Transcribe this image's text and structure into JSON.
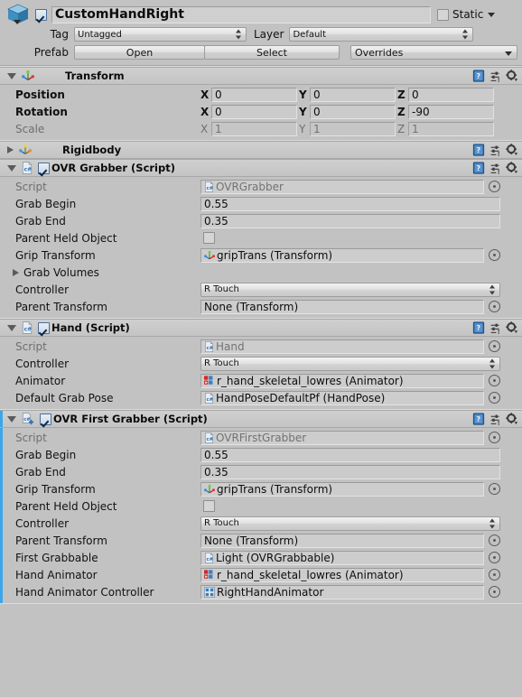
{
  "object_header": {
    "icon": "cube-icon",
    "enabled": true,
    "name": "CustomHandRight",
    "static_label": "Static",
    "static_checked": false,
    "tag_label": "Tag",
    "tag_value": "Untagged",
    "layer_label": "Layer",
    "layer_value": "Default",
    "prefab_label": "Prefab",
    "prefab_open": "Open",
    "prefab_select": "Select",
    "prefab_overrides": "Overrides"
  },
  "components": [
    {
      "id": "transform",
      "title": "Transform",
      "icon": "transform-icon",
      "expanded": true,
      "has_checkbox": false,
      "rows": [
        {
          "kind": "vector3",
          "label": "Position",
          "bold": true,
          "axes": [
            "X",
            "Y",
            "Z"
          ],
          "values": [
            "0",
            "0",
            "0"
          ]
        },
        {
          "kind": "vector3",
          "label": "Rotation",
          "bold": true,
          "axes": [
            "X",
            "Y",
            "Z"
          ],
          "values": [
            "0",
            "0",
            "-90"
          ]
        },
        {
          "kind": "vector3",
          "label": "Scale",
          "bold": false,
          "dim": true,
          "axes": [
            "X",
            "Y",
            "Z"
          ],
          "values": [
            "1",
            "1",
            "1"
          ]
        }
      ]
    },
    {
      "id": "rigidbody",
      "title": "Rigidbody",
      "icon": "transform-icon",
      "expanded": false,
      "has_checkbox": false,
      "rows": []
    },
    {
      "id": "ovr-grabber",
      "title": "OVR Grabber (Script)",
      "icon": "script-icon",
      "expanded": true,
      "has_checkbox": true,
      "checked": true,
      "rows": [
        {
          "kind": "object",
          "label": "Script",
          "dim": true,
          "readonly": true,
          "value": "OVRGrabber",
          "value_icon": "script-icon"
        },
        {
          "kind": "text",
          "label": "Grab Begin",
          "value": "0.55"
        },
        {
          "kind": "text",
          "label": "Grab End",
          "value": "0.35"
        },
        {
          "kind": "checkbox",
          "label": "Parent Held Object",
          "checked": false
        },
        {
          "kind": "object",
          "label": "Grip Transform",
          "value": "gripTrans (Transform)",
          "value_icon": "transform-icon"
        },
        {
          "kind": "foldout",
          "label": "Grab Volumes"
        },
        {
          "kind": "popup",
          "label": "Controller",
          "value": "R Touch"
        },
        {
          "kind": "object",
          "label": "Parent Transform",
          "value": "None (Transform)",
          "value_icon": "none"
        }
      ]
    },
    {
      "id": "hand",
      "title": "Hand (Script)",
      "icon": "script-icon",
      "expanded": true,
      "has_checkbox": true,
      "checked": true,
      "rows": [
        {
          "kind": "object",
          "label": "Script",
          "dim": true,
          "readonly": true,
          "value": "Hand",
          "value_icon": "script-icon"
        },
        {
          "kind": "popup",
          "label": "Controller",
          "value": "R Touch"
        },
        {
          "kind": "object",
          "label": "Animator",
          "value": "r_hand_skeletal_lowres (Animator)",
          "value_icon": "animator-icon"
        },
        {
          "kind": "object",
          "label": "Default Grab Pose",
          "value": "HandPoseDefaultPf (HandPose)",
          "value_icon": "script-icon"
        }
      ]
    },
    {
      "id": "ovr-first-grabber",
      "title": "OVR First Grabber (Script)",
      "icon": "script-add-icon",
      "expanded": true,
      "has_checkbox": true,
      "checked": true,
      "accent": "#3ba6e8",
      "rows": [
        {
          "kind": "object",
          "label": "Script",
          "dim": true,
          "readonly": true,
          "value": "OVRFirstGrabber",
          "value_icon": "script-icon"
        },
        {
          "kind": "text",
          "label": "Grab Begin",
          "value": "0.55"
        },
        {
          "kind": "text",
          "label": "Grab End",
          "value": "0.35"
        },
        {
          "kind": "object",
          "label": "Grip Transform",
          "value": "gripTrans (Transform)",
          "value_icon": "transform-icon"
        },
        {
          "kind": "checkbox",
          "label": "Parent Held Object",
          "checked": false
        },
        {
          "kind": "popup",
          "label": "Controller",
          "value": "R Touch"
        },
        {
          "kind": "object",
          "label": "Parent Transform",
          "value": "None (Transform)",
          "value_icon": "none"
        },
        {
          "kind": "object",
          "label": "First Grabbable",
          "value": "Light (OVRGrabbable)",
          "value_icon": "script-icon"
        },
        {
          "kind": "object",
          "label": "Hand Animator",
          "value": "r_hand_skeletal_lowres (Animator)",
          "value_icon": "animator-icon"
        },
        {
          "kind": "object",
          "label": "Hand Animator Controller",
          "value": "RightHandAnimator",
          "value_icon": "animator-controller-icon"
        }
      ]
    }
  ],
  "header_icon_names": [
    "help-icon",
    "preset-icon",
    "gear-icon"
  ]
}
